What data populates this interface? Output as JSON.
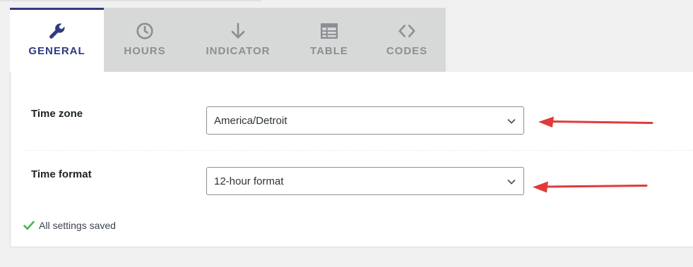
{
  "tabs": [
    {
      "label": "GENERAL",
      "icon": "wrench-icon",
      "active": true
    },
    {
      "label": "HOURS",
      "icon": "clock-icon",
      "active": false
    },
    {
      "label": "INDICATOR",
      "icon": "arrow-down-icon",
      "active": false
    },
    {
      "label": "TABLE",
      "icon": "table-icon",
      "active": false
    },
    {
      "label": "CODES",
      "icon": "code-icon",
      "active": false
    }
  ],
  "settings": {
    "timezone": {
      "label": "Time zone",
      "value": "America/Detroit"
    },
    "timeformat": {
      "label": "Time format",
      "value": "12-hour format"
    }
  },
  "status": {
    "text": "All settings saved"
  },
  "colors": {
    "accent": "#2f3a84",
    "inactive_tab": "#8a8f93",
    "tabbar_bg": "#d7d9d8",
    "arrow": "#e03a3a",
    "check": "#46b450"
  }
}
